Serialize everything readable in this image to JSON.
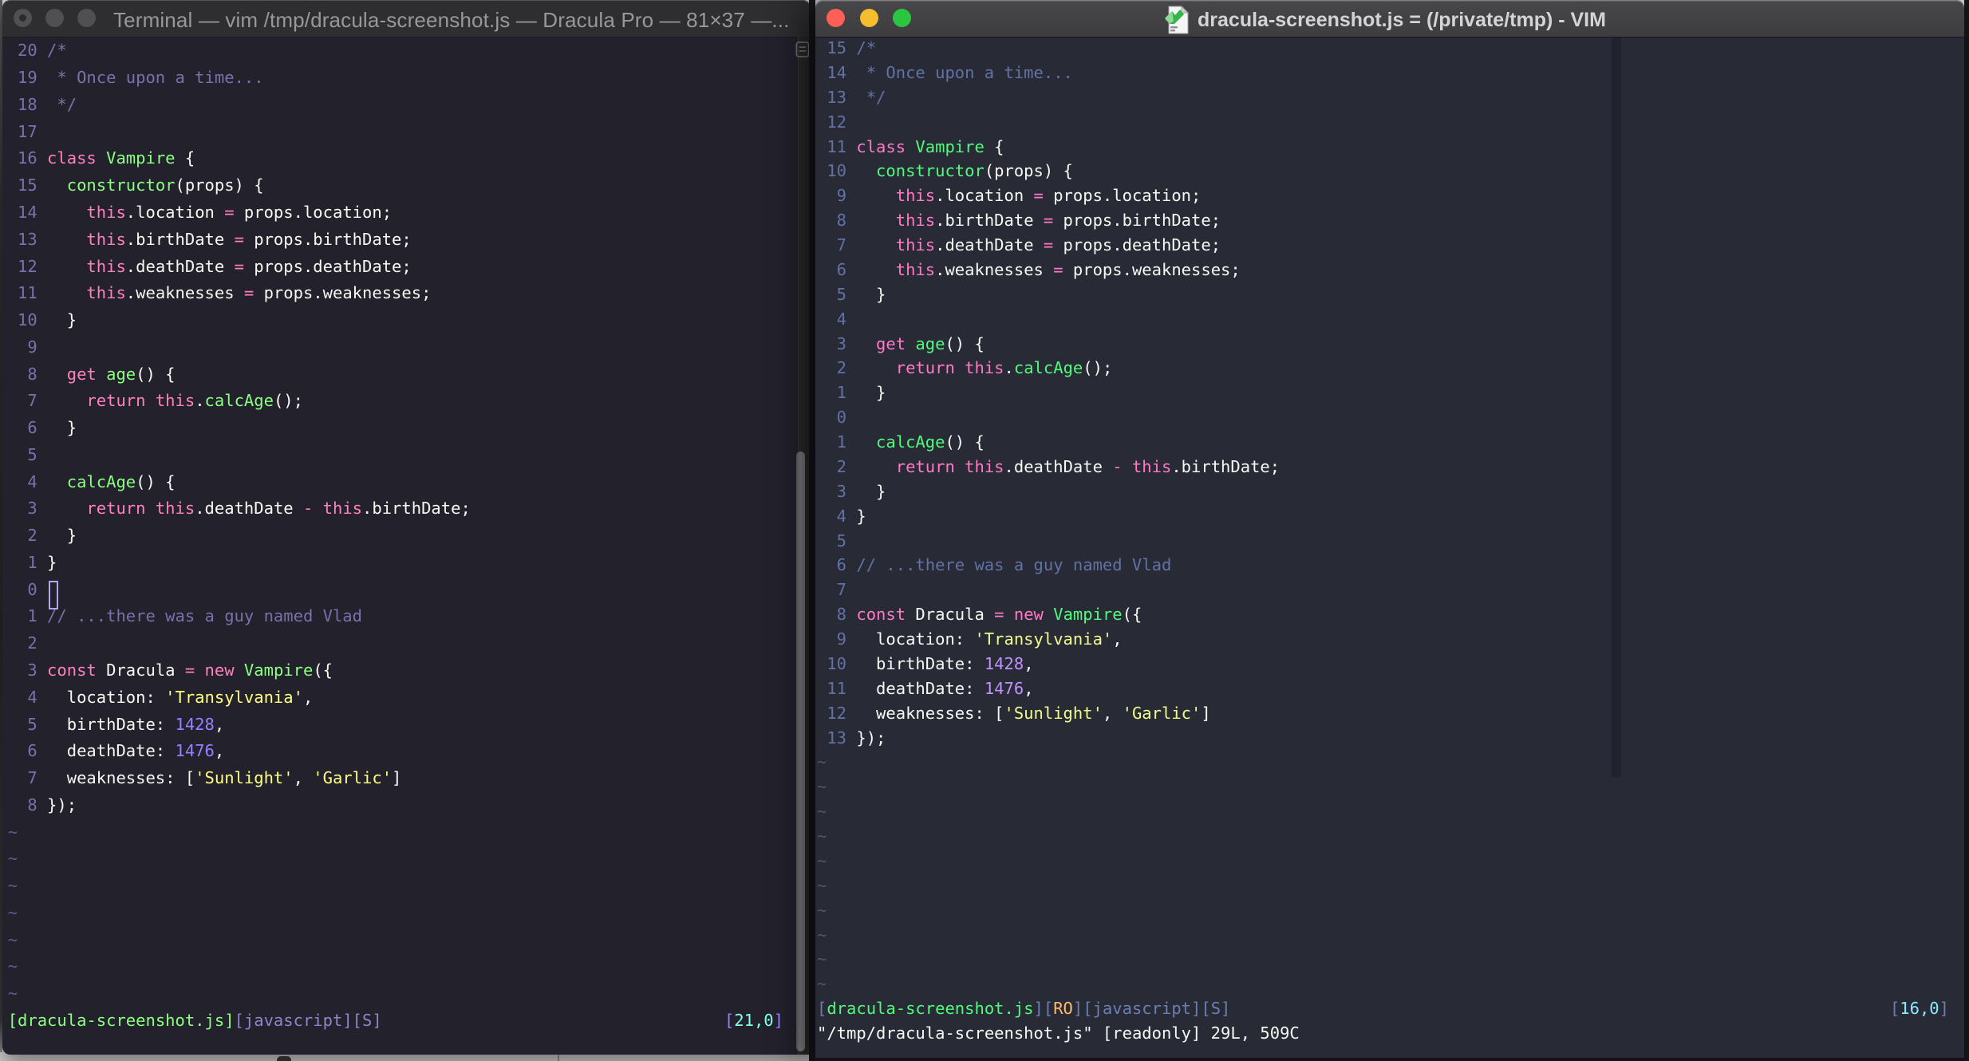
{
  "desktop": {
    "background": "#D3D3D1"
  },
  "left_window": {
    "app": "Terminal",
    "title": "Terminal — vim /tmp/dracula-screenshot.js — Dracula Pro — 81×37 —...",
    "theme_name": "Dracula Pro",
    "terminal_size": "81×37",
    "palette": {
      "bg": "#22212C",
      "fg": "#F8F8F2",
      "ln": "#7A71AC",
      "cm": "#7A71AC",
      "kw": "#FF80BF",
      "fn": "#8AFF80",
      "st": "#FFFF80",
      "nu": "#9580FF",
      "tl": "#615B8E",
      "sg": "#8AFF80",
      "sb": "#8E85C9",
      "sp": "#9580FF",
      "sc": "#80FFEA"
    },
    "rows": [
      {
        "n": "20",
        "t": [
          [
            "cm",
            "/*"
          ]
        ]
      },
      {
        "n": "19",
        "t": [
          [
            "cm",
            " * Once upon a time..."
          ]
        ]
      },
      {
        "n": "18",
        "t": [
          [
            "cm",
            " */"
          ]
        ]
      },
      {
        "n": "17"
      },
      {
        "n": "16",
        "t": [
          [
            "kw",
            "class"
          ],
          [
            "fg",
            " "
          ],
          [
            "fn",
            "Vampire"
          ],
          [
            "fg",
            " {"
          ]
        ]
      },
      {
        "n": "15",
        "t": [
          [
            "fg",
            "  "
          ],
          [
            "fn",
            "constructor"
          ],
          [
            "fg",
            "(props) {"
          ]
        ]
      },
      {
        "n": "14",
        "t": [
          [
            "fg",
            "    "
          ],
          [
            "kw",
            "this"
          ],
          [
            "fg",
            ".location "
          ],
          [
            "kw",
            "="
          ],
          [
            "fg",
            " props.location;"
          ]
        ]
      },
      {
        "n": "13",
        "t": [
          [
            "fg",
            "    "
          ],
          [
            "kw",
            "this"
          ],
          [
            "fg",
            ".birthDate "
          ],
          [
            "kw",
            "="
          ],
          [
            "fg",
            " props.birthDate;"
          ]
        ]
      },
      {
        "n": "12",
        "t": [
          [
            "fg",
            "    "
          ],
          [
            "kw",
            "this"
          ],
          [
            "fg",
            ".deathDate "
          ],
          [
            "kw",
            "="
          ],
          [
            "fg",
            " props.deathDate;"
          ]
        ]
      },
      {
        "n": "11",
        "t": [
          [
            "fg",
            "    "
          ],
          [
            "kw",
            "this"
          ],
          [
            "fg",
            ".weaknesses "
          ],
          [
            "kw",
            "="
          ],
          [
            "fg",
            " props.weaknesses;"
          ]
        ]
      },
      {
        "n": "10",
        "t": [
          [
            "fg",
            "  }"
          ]
        ]
      },
      {
        "n": "9"
      },
      {
        "n": "8",
        "t": [
          [
            "fg",
            "  "
          ],
          [
            "kw",
            "get"
          ],
          [
            "fg",
            " "
          ],
          [
            "fn",
            "age"
          ],
          [
            "fg",
            "() {"
          ]
        ]
      },
      {
        "n": "7",
        "t": [
          [
            "fg",
            "    "
          ],
          [
            "kw",
            "return"
          ],
          [
            "fg",
            " "
          ],
          [
            "kw",
            "this"
          ],
          [
            "fg",
            "."
          ],
          [
            "fn",
            "calcAge"
          ],
          [
            "fg",
            "();"
          ]
        ]
      },
      {
        "n": "6",
        "t": [
          [
            "fg",
            "  }"
          ]
        ]
      },
      {
        "n": "5"
      },
      {
        "n": "4",
        "t": [
          [
            "fg",
            "  "
          ],
          [
            "fn",
            "calcAge"
          ],
          [
            "fg",
            "() {"
          ]
        ]
      },
      {
        "n": "3",
        "t": [
          [
            "fg",
            "    "
          ],
          [
            "kw",
            "return"
          ],
          [
            "fg",
            " "
          ],
          [
            "kw",
            "this"
          ],
          [
            "fg",
            ".deathDate "
          ],
          [
            "kw",
            "-"
          ],
          [
            "fg",
            " "
          ],
          [
            "kw",
            "this"
          ],
          [
            "fg",
            ".birthDate;"
          ]
        ]
      },
      {
        "n": "2",
        "t": [
          [
            "fg",
            "  }"
          ]
        ]
      },
      {
        "n": "1",
        "t": [
          [
            "fg",
            "}"
          ]
        ]
      },
      {
        "n": "0",
        "cursor": true
      },
      {
        "n": "1",
        "t": [
          [
            "cm",
            "// ...there was a guy named Vlad"
          ]
        ]
      },
      {
        "n": "2"
      },
      {
        "n": "3",
        "t": [
          [
            "kw",
            "const"
          ],
          [
            "fg",
            " Dracula "
          ],
          [
            "kw",
            "="
          ],
          [
            "fg",
            " "
          ],
          [
            "kw",
            "new"
          ],
          [
            "fg",
            " "
          ],
          [
            "fn",
            "Vampire"
          ],
          [
            "fg",
            "({"
          ]
        ]
      },
      {
        "n": "4",
        "t": [
          [
            "fg",
            "  location: "
          ],
          [
            "st",
            "'Transylvania'"
          ],
          [
            "fg",
            ","
          ]
        ]
      },
      {
        "n": "5",
        "t": [
          [
            "fg",
            "  birthDate: "
          ],
          [
            "nu",
            "1428"
          ],
          [
            "fg",
            ","
          ]
        ]
      },
      {
        "n": "6",
        "t": [
          [
            "fg",
            "  deathDate: "
          ],
          [
            "nu",
            "1476"
          ],
          [
            "fg",
            ","
          ]
        ]
      },
      {
        "n": "7",
        "t": [
          [
            "fg",
            "  weaknesses: ["
          ],
          [
            "st",
            "'Sunlight'"
          ],
          [
            "fg",
            ", "
          ],
          [
            "st",
            "'Garlic'"
          ],
          [
            "fg",
            "]"
          ]
        ]
      },
      {
        "n": "8",
        "t": [
          [
            "fg",
            "});"
          ]
        ]
      }
    ],
    "tildes": 7,
    "status": {
      "left": [
        [
          "sg",
          "[dracula-screenshot.js]"
        ],
        [
          "sb",
          "[javascript][S]"
        ]
      ],
      "right": [
        [
          "sp",
          "["
        ],
        [
          "sc",
          "21,0"
        ],
        [
          "sp",
          "]"
        ]
      ]
    },
    "cursor_position": "21,0"
  },
  "right_window": {
    "app": "MacVim",
    "title": "dracula-screenshot.js = (/private/tmp) - VIM",
    "theme_name": "Dracula",
    "palette": {
      "bg": "#282A36",
      "fg": "#F8F8F2",
      "ln": "#6272A4",
      "cm": "#6272A4",
      "kw": "#FF79C6",
      "fn": "#50FA7B",
      "st": "#F1FA8C",
      "nu": "#BD93F9",
      "tl": "#4D5671",
      "sg": "#50FA7B",
      "sb": "#6D7EB0",
      "sp": "#6D7EB0",
      "sc": "#8BE9FD",
      "so": "#FFB86C"
    },
    "rows": [
      {
        "n": "15",
        "t": [
          [
            "cm",
            "/*"
          ]
        ]
      },
      {
        "n": "14",
        "t": [
          [
            "cm",
            " * Once upon a time..."
          ]
        ]
      },
      {
        "n": "13",
        "t": [
          [
            "cm",
            " */"
          ]
        ]
      },
      {
        "n": "12"
      },
      {
        "n": "11",
        "t": [
          [
            "kw",
            "class"
          ],
          [
            "fg",
            " "
          ],
          [
            "fn",
            "Vampire"
          ],
          [
            "fg",
            " {"
          ]
        ]
      },
      {
        "n": "10",
        "t": [
          [
            "fg",
            "  "
          ],
          [
            "fn",
            "constructor"
          ],
          [
            "fg",
            "(props) {"
          ]
        ]
      },
      {
        "n": "9",
        "t": [
          [
            "fg",
            "    "
          ],
          [
            "kw",
            "this"
          ],
          [
            "fg",
            ".location "
          ],
          [
            "kw",
            "="
          ],
          [
            "fg",
            " props.location;"
          ]
        ]
      },
      {
        "n": "8",
        "t": [
          [
            "fg",
            "    "
          ],
          [
            "kw",
            "this"
          ],
          [
            "fg",
            ".birthDate "
          ],
          [
            "kw",
            "="
          ],
          [
            "fg",
            " props.birthDate;"
          ]
        ]
      },
      {
        "n": "7",
        "t": [
          [
            "fg",
            "    "
          ],
          [
            "kw",
            "this"
          ],
          [
            "fg",
            ".deathDate "
          ],
          [
            "kw",
            "="
          ],
          [
            "fg",
            " props.deathDate;"
          ]
        ]
      },
      {
        "n": "6",
        "t": [
          [
            "fg",
            "    "
          ],
          [
            "kw",
            "this"
          ],
          [
            "fg",
            ".weaknesses "
          ],
          [
            "kw",
            "="
          ],
          [
            "fg",
            " props.weaknesses;"
          ]
        ]
      },
      {
        "n": "5",
        "t": [
          [
            "fg",
            "  }"
          ]
        ]
      },
      {
        "n": "4"
      },
      {
        "n": "3",
        "t": [
          [
            "fg",
            "  "
          ],
          [
            "kw",
            "get"
          ],
          [
            "fg",
            " "
          ],
          [
            "fn",
            "age"
          ],
          [
            "fg",
            "() {"
          ]
        ]
      },
      {
        "n": "2",
        "t": [
          [
            "fg",
            "    "
          ],
          [
            "kw",
            "return"
          ],
          [
            "fg",
            " "
          ],
          [
            "kw",
            "this"
          ],
          [
            "fg",
            "."
          ],
          [
            "fn",
            "calcAge"
          ],
          [
            "fg",
            "();"
          ]
        ]
      },
      {
        "n": "1",
        "t": [
          [
            "fg",
            "  }"
          ]
        ]
      },
      {
        "n": "0",
        "cursor": true
      },
      {
        "n": "1",
        "t": [
          [
            "fg",
            "  "
          ],
          [
            "fn",
            "calcAge"
          ],
          [
            "fg",
            "() {"
          ]
        ]
      },
      {
        "n": "2",
        "t": [
          [
            "fg",
            "    "
          ],
          [
            "kw",
            "return"
          ],
          [
            "fg",
            " "
          ],
          [
            "kw",
            "this"
          ],
          [
            "fg",
            ".deathDate "
          ],
          [
            "kw",
            "-"
          ],
          [
            "fg",
            " "
          ],
          [
            "kw",
            "this"
          ],
          [
            "fg",
            ".birthDate;"
          ]
        ]
      },
      {
        "n": "3",
        "t": [
          [
            "fg",
            "  }"
          ]
        ]
      },
      {
        "n": "4",
        "t": [
          [
            "fg",
            "}"
          ]
        ]
      },
      {
        "n": "5"
      },
      {
        "n": "6",
        "t": [
          [
            "cm",
            "// ...there was a guy named Vlad"
          ]
        ]
      },
      {
        "n": "7"
      },
      {
        "n": "8",
        "t": [
          [
            "kw",
            "const"
          ],
          [
            "fg",
            " Dracula "
          ],
          [
            "kw",
            "="
          ],
          [
            "fg",
            " "
          ],
          [
            "kw",
            "new"
          ],
          [
            "fg",
            " "
          ],
          [
            "fn",
            "Vampire"
          ],
          [
            "fg",
            "({"
          ]
        ]
      },
      {
        "n": "9",
        "t": [
          [
            "fg",
            "  location: "
          ],
          [
            "st",
            "'Transylvania'"
          ],
          [
            "fg",
            ","
          ]
        ]
      },
      {
        "n": "10",
        "t": [
          [
            "fg",
            "  birthDate: "
          ],
          [
            "nu",
            "1428"
          ],
          [
            "fg",
            ","
          ]
        ]
      },
      {
        "n": "11",
        "t": [
          [
            "fg",
            "  deathDate: "
          ],
          [
            "nu",
            "1476"
          ],
          [
            "fg",
            ","
          ]
        ]
      },
      {
        "n": "12",
        "t": [
          [
            "fg",
            "  weaknesses: ["
          ],
          [
            "st",
            "'Sunlight'"
          ],
          [
            "fg",
            ", "
          ],
          [
            "st",
            "'Garlic'"
          ],
          [
            "fg",
            "]"
          ]
        ]
      },
      {
        "n": "13",
        "t": [
          [
            "fg",
            "});"
          ]
        ]
      }
    ],
    "tildes": 10,
    "status": {
      "left": [
        [
          "sp",
          "["
        ],
        [
          "sg",
          "dracula-screenshot.js"
        ],
        [
          "sp",
          "]["
        ],
        [
          "so",
          "RO"
        ],
        [
          "sp",
          "]["
        ],
        [
          "sb",
          "javascript"
        ],
        [
          "sp",
          "]["
        ],
        [
          "sb",
          "S"
        ],
        [
          "sp",
          "]"
        ]
      ],
      "right": [
        [
          "sp",
          "["
        ],
        [
          "sc",
          "16,0"
        ],
        [
          "sp",
          "]"
        ]
      ]
    },
    "message": "\"/tmp/dracula-screenshot.js\" [readonly] 29L, 509C",
    "cursor_position": "16,0"
  }
}
